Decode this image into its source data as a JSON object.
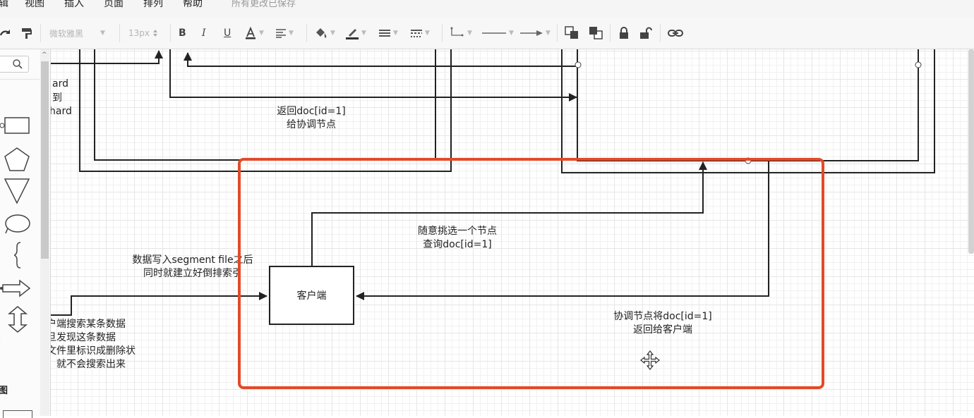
{
  "menubar": {
    "items": [
      "辑",
      "视图",
      "插入",
      "页面",
      "排列",
      "帮助"
    ],
    "save_status": "所有更改已保存"
  },
  "toolbar": {
    "font_family": "微软雅黑",
    "font_size": "13px",
    "icons": [
      "redo-icon",
      "format-painter-icon",
      "bold-icon",
      "italic-icon",
      "underline-icon",
      "font-color-icon",
      "align-icon",
      "fill-color-icon",
      "line-color-icon",
      "line-width-icon",
      "line-style-icon",
      "connector-icon",
      "line-end-icon",
      "arrow-end-icon",
      "to-front-icon",
      "to-back-icon",
      "lock-icon",
      "unlock-icon",
      "link-icon"
    ]
  },
  "sidebar": {
    "search_placeholder": "",
    "section_label": "图",
    "shapes": [
      "rectangle",
      "pentagon",
      "triangle",
      "ellipse",
      "curly-brace",
      "arrow",
      "double-arrow"
    ]
  },
  "canvas": {
    "labels": {
      "left_top_1": "ard",
      "left_top_2": "到",
      "left_top_3": "hard",
      "return_doc_1": "返回doc[id=1]",
      "return_doc_2": "给协调节点",
      "random_pick_1": "随意挑选一个节点",
      "random_pick_2": "查询doc[id=1]",
      "segment_1": "数据写入segment file之后",
      "segment_2": "同时就建立好倒排索引",
      "search_1": "户端搜索某条数据",
      "search_2": "旦发现这条数据",
      "search_3": "文件里标识成删除状",
      "search_4": "，就不会搜索出来",
      "coordinator_return_1": "协调节点将doc[id=1]",
      "coordinator_return_2": "返回给客户端"
    },
    "client_box": "客户端",
    "highlight_color": "#e24a2a"
  }
}
